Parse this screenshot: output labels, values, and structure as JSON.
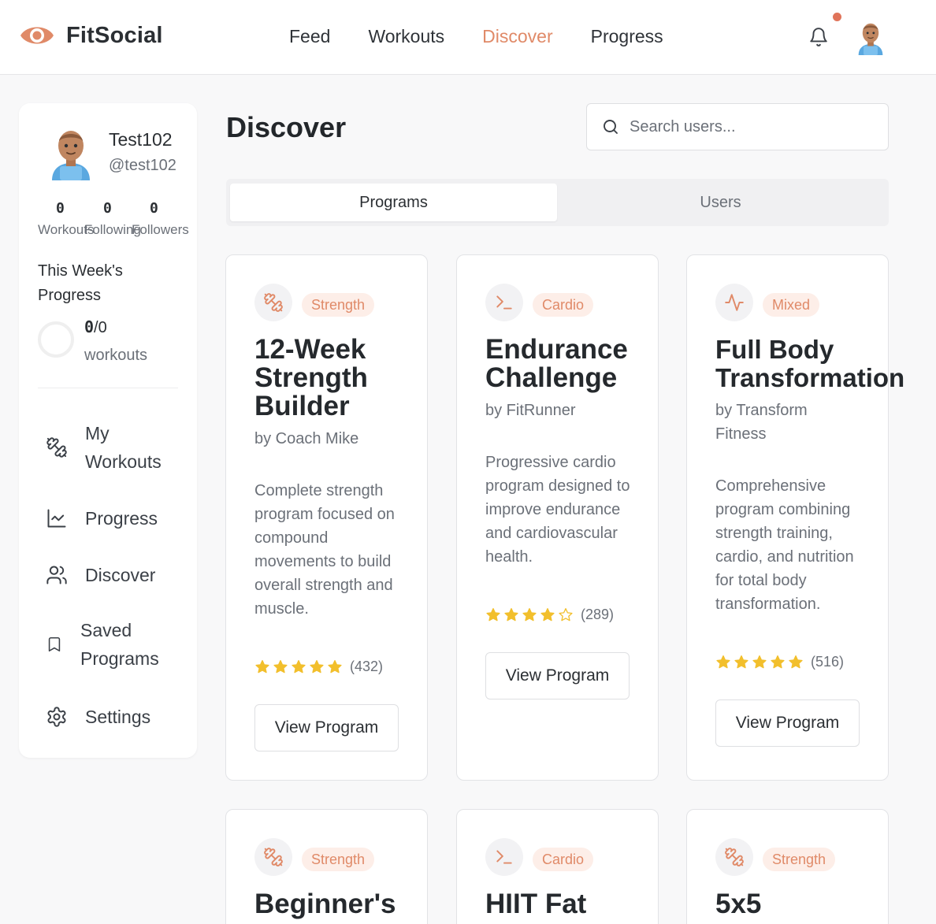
{
  "app": {
    "name": "FitSocial",
    "accent": "#e08a68"
  },
  "nav": {
    "items": [
      "Feed",
      "Workouts",
      "Discover",
      "Progress"
    ],
    "active": "Discover"
  },
  "header": {
    "notifications_icon": "bell-icon",
    "has_unread": true
  },
  "profile": {
    "name": "Test102",
    "handle": "@test102"
  },
  "stats": [
    {
      "value": "0",
      "label": "Workouts"
    },
    {
      "value": "0",
      "label": "Following"
    },
    {
      "value": "0",
      "label": "Followers"
    }
  ],
  "week": {
    "title": "This Week's Progress",
    "done": "0",
    "total": "/0",
    "unit": "workouts"
  },
  "sidebar": {
    "items": [
      {
        "label": "My Workouts",
        "icon": "dumbbell-icon"
      },
      {
        "label": "Progress",
        "icon": "chart-icon"
      },
      {
        "label": "Discover",
        "icon": "users-icon"
      },
      {
        "label": "Saved Programs",
        "icon": "bookmark-icon"
      },
      {
        "label": "Settings",
        "icon": "gear-icon"
      }
    ]
  },
  "page": {
    "title": "Discover"
  },
  "search": {
    "placeholder": "Search users..."
  },
  "tabs": [
    {
      "label": "Programs",
      "active": true
    },
    {
      "label": "Users",
      "active": false
    }
  ],
  "programs": [
    {
      "category": "Strength",
      "icon": "dumbbell-icon",
      "title": "12-Week Strength Builder",
      "author": "by Coach Mike",
      "description": "Complete strength program focused on compound movements to build overall strength and muscle.",
      "rating": 5,
      "count": "(432)",
      "button": "View Program"
    },
    {
      "category": "Cardio",
      "icon": "terminal-icon",
      "title": "Endurance Challenge",
      "author": "by FitRunner",
      "description": "Progressive cardio program designed to improve endurance and cardiovascular health.",
      "rating": 4,
      "count": "(289)",
      "button": "View Program"
    },
    {
      "category": "Mixed",
      "icon": "activity-icon",
      "title": "Full Body Transformation",
      "author": "by Transform Fitness",
      "description": "Comprehensive program combining strength training, cardio, and nutrition for total body transformation.",
      "rating": 5,
      "count": "(516)",
      "button": "View Program"
    },
    {
      "category": "Strength",
      "icon": "dumbbell-icon",
      "title": "Beginner's",
      "author": "",
      "description": "",
      "rating": 0,
      "count": "",
      "button": ""
    },
    {
      "category": "Cardio",
      "icon": "terminal-icon",
      "title": "HIIT Fat",
      "author": "",
      "description": "",
      "rating": 0,
      "count": "",
      "button": ""
    },
    {
      "category": "Strength",
      "icon": "dumbbell-icon",
      "title": "5x5",
      "author": "",
      "description": "",
      "rating": 0,
      "count": "",
      "button": ""
    }
  ]
}
